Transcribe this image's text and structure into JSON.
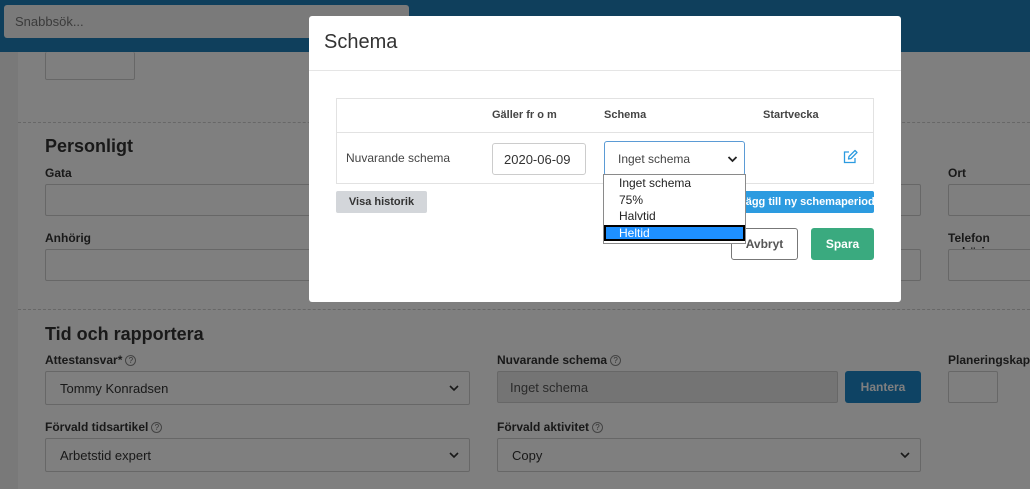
{
  "topbar": {
    "quick_search_placeholder": "Snabbsök..."
  },
  "sections": {
    "personal": {
      "title": "Personligt",
      "gata_label": "Gata",
      "ort_label": "Ort",
      "anhorig_label": "Anhörig",
      "telefon_label": "Telefon anhörig"
    },
    "time": {
      "title": "Tid och rapportera",
      "attest_label": "Attestansvar*",
      "attest_value": "Tommy Konradsen",
      "current_schema_label": "Nuvarande schema",
      "current_schema_value": "Inget schema",
      "hantera_label": "Hantera",
      "capacity_label": "Planeringskapa",
      "default_article_label": "Förvald tidsartikel",
      "default_article_value": "Arbetstid expert",
      "default_activity_label": "Förvald aktivitet",
      "default_activity_value": "Copy"
    }
  },
  "modal": {
    "title": "Schema",
    "table": {
      "headers": [
        "Gäller fr o m",
        "Schema",
        "Startvecka"
      ],
      "row_label": "Nuvarande schema",
      "date_value": "2020-06-09",
      "schema_selected": "Inget schema"
    },
    "history_button": "Visa historik",
    "add_period_button": "Lägg till ny schemaperiod",
    "cancel_button": "Avbryt",
    "save_button": "Spara",
    "dropdown_options": [
      "Inget schema",
      "75%",
      "Halvtid",
      "Heltid"
    ],
    "dropdown_highlighted": "Heltid"
  },
  "colors": {
    "topbar": "#1e7fb8",
    "primary_blue": "#1d86c8",
    "save_green": "#3aaa7f",
    "highlight": "#1e90ff"
  }
}
